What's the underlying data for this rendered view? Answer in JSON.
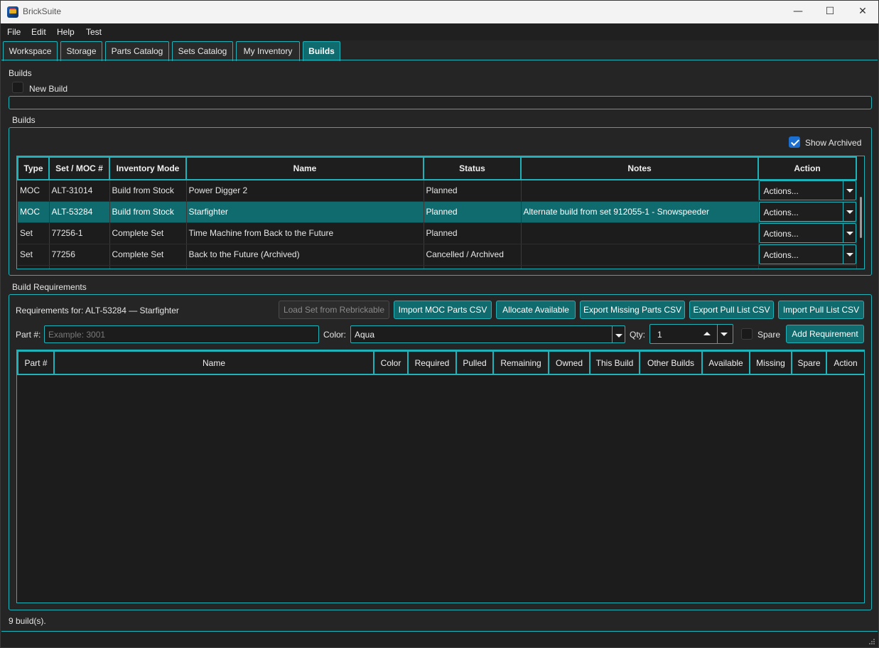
{
  "window": {
    "title": "BrickSuite",
    "minimize": "—",
    "maximize": "☐",
    "close": "✕"
  },
  "menu": [
    "File",
    "Edit",
    "Help",
    "Test"
  ],
  "tabs": [
    "Workspace",
    "Storage",
    "Parts Catalog",
    "Sets Catalog",
    "My Inventory",
    "Builds"
  ],
  "active_tab": "Builds",
  "header": {
    "section_label": "Builds",
    "new_build_label": "New Build",
    "new_build_checked": false
  },
  "builds_group": {
    "title": "Builds",
    "show_archived_label": "Show Archived",
    "show_archived_checked": true,
    "columns": [
      "Type",
      "Set / MOC #",
      "Inventory Mode",
      "Name",
      "Status",
      "Notes",
      "Action"
    ],
    "rows": [
      {
        "type": "MOC",
        "num": "ALT-31014",
        "mode": "Build from Stock",
        "name": "Power Digger 2",
        "status": "Planned",
        "notes": "",
        "action": "Actions..."
      },
      {
        "type": "MOC",
        "num": "ALT-53284",
        "mode": "Build from Stock",
        "name": "Starfighter",
        "status": "Planned",
        "notes": "Alternate build from set 912055-1 - Snowspeeder",
        "action": "Actions..."
      },
      {
        "type": "Set",
        "num": "77256-1",
        "mode": "Complete Set",
        "name": "Time Machine from Back to the Future",
        "status": "Planned",
        "notes": "",
        "action": "Actions..."
      },
      {
        "type": "Set",
        "num": "77256",
        "mode": "Complete Set",
        "name": "Back to the Future (Archived)",
        "status": "Cancelled / Archived",
        "notes": "",
        "action": "Actions..."
      }
    ],
    "selected_row": 1
  },
  "requirements": {
    "title": "Build Requirements",
    "for_label": "Requirements for: ALT-53284 — Starfighter",
    "buttons": {
      "load_set": "Load Set from Rebrickable",
      "import_moc": "Import MOC Parts CSV",
      "allocate": "Allocate Available",
      "export_missing": "Export Missing Parts CSV",
      "export_pull": "Export Pull List CSV",
      "import_pull": "Import Pull List CSV",
      "add_requirement": "Add Requirement"
    },
    "part_label": "Part #:",
    "part_placeholder": "Example: 3001",
    "color_label": "Color:",
    "color_value": "Aqua",
    "qty_label": "Qty:",
    "qty_value": "1",
    "spare_label": "Spare",
    "spare_checked": false,
    "columns": [
      "Part #",
      "Name",
      "Color",
      "Required",
      "Pulled",
      "Remaining",
      "Owned",
      "This Build",
      "Other Builds",
      "Available",
      "Missing",
      "Spare",
      "Action"
    ]
  },
  "status": {
    "text": "9 build(s)."
  }
}
